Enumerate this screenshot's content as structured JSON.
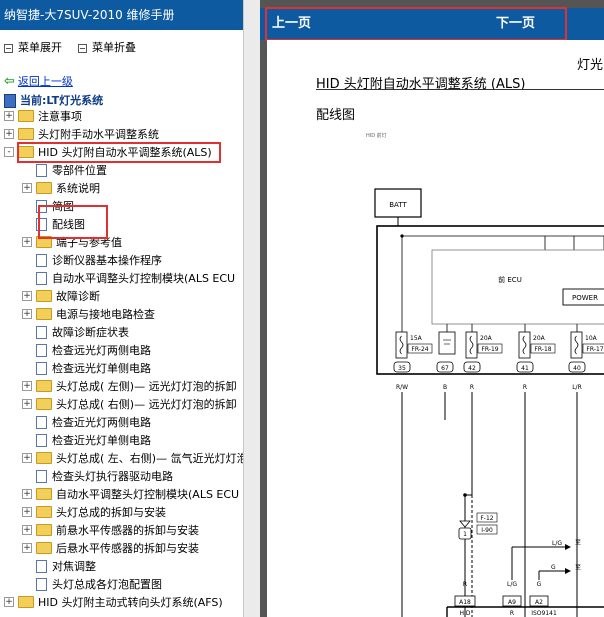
{
  "left_panel": {
    "title": "纳智捷-大7SUV-2010 维修手册",
    "expand_label": "菜单展开",
    "collapse_label": "菜单折叠",
    "back_label": "返回上一级",
    "current_label": "当前:LT灯光系统",
    "tree": [
      {
        "label": "注意事项",
        "type": "folder",
        "level": 0,
        "toggle": "+"
      },
      {
        "label": "头灯附手动水平调整系统",
        "type": "folder",
        "level": 0,
        "toggle": "+"
      },
      {
        "label": "HID 头灯附自动水平调整系统(ALS)",
        "type": "folder",
        "level": 0,
        "toggle": "-"
      },
      {
        "label": "零部件位置",
        "type": "doc",
        "level": 1
      },
      {
        "label": "系统说明",
        "type": "folder",
        "level": 1,
        "toggle": "+"
      },
      {
        "label": "简图",
        "type": "doc",
        "level": 1
      },
      {
        "label": "配线图",
        "type": "doc",
        "level": 1
      },
      {
        "label": "端子与参考值",
        "type": "folder",
        "level": 1,
        "toggle": "+"
      },
      {
        "label": "诊断仪器基本操作程序",
        "type": "doc",
        "level": 1
      },
      {
        "label": "自动水平调整头灯控制模块(ALS ECU",
        "type": "doc",
        "level": 1
      },
      {
        "label": "故障诊断",
        "type": "folder",
        "level": 1,
        "toggle": "+"
      },
      {
        "label": "电源与接地电路检查",
        "type": "folder",
        "level": 1,
        "toggle": "+"
      },
      {
        "label": "故障诊断症状表",
        "type": "doc",
        "level": 1
      },
      {
        "label": "检查远光灯两侧电路",
        "type": "doc",
        "level": 1
      },
      {
        "label": "检查远光灯单侧电路",
        "type": "doc",
        "level": 1
      },
      {
        "label": "头灯总成( 左侧)— 远光灯灯泡的拆卸",
        "type": "folder",
        "level": 1,
        "toggle": "+"
      },
      {
        "label": "头灯总成( 右侧)— 远光灯灯泡的拆卸",
        "type": "folder",
        "level": 1,
        "toggle": "+"
      },
      {
        "label": "检查近光灯两侧电路",
        "type": "doc",
        "level": 1
      },
      {
        "label": "检查近光灯单侧电路",
        "type": "doc",
        "level": 1
      },
      {
        "label": "头灯总成( 左、右侧)— 氙气近光灯灯泡",
        "type": "folder",
        "level": 1,
        "toggle": "+"
      },
      {
        "label": "检查头灯执行器驱动电路",
        "type": "doc",
        "level": 1
      },
      {
        "label": "自动水平调整头灯控制模块(ALS ECU",
        "type": "folder",
        "level": 1,
        "toggle": "+"
      },
      {
        "label": "头灯总成的拆卸与安装",
        "type": "folder",
        "level": 1,
        "toggle": "+"
      },
      {
        "label": "前悬水平传感器的拆卸与安装",
        "type": "folder",
        "level": 1,
        "toggle": "+"
      },
      {
        "label": "后悬水平传感器的拆卸与安装",
        "type": "folder",
        "level": 1,
        "toggle": "+"
      },
      {
        "label": "对焦调整",
        "type": "doc",
        "level": 1
      },
      {
        "label": "头灯总成各灯泡配置图",
        "type": "doc",
        "level": 1
      },
      {
        "label": "HID 头灯附主动式转向头灯系统(AFS)",
        "type": "folder",
        "level": 0,
        "toggle": "+"
      }
    ]
  },
  "nav": {
    "prev_label": "上一页",
    "next_label": "下一页"
  },
  "document": {
    "corner_text": "灯光",
    "section_title": "HID 头灯附自动水平调整系统 (ALS)",
    "sub_title": "配线图",
    "tiny_label": "HID 前灯",
    "batt_label": "BATT",
    "ecu_label": "前 ECU",
    "power_label": "POWER",
    "fuses": [
      {
        "amp": "15A",
        "code": "FR-24",
        "pin": "35",
        "wire": "R/W"
      },
      {
        "amp": "",
        "code": "",
        "pin": "67",
        "wire": "B"
      },
      {
        "amp": "20A",
        "code": "FR-19",
        "pin": "42",
        "wire": "R"
      },
      {
        "amp": "20A",
        "code": "FR-18",
        "pin": "41",
        "wire": "R"
      },
      {
        "amp": "10A",
        "code": "FR-17",
        "pin": "40",
        "wire": "L/R"
      }
    ],
    "connector_f12": "F-12",
    "connector_i90": "I-90",
    "connector_pin": "1",
    "wire_r": "R",
    "wire_lg": "L/G",
    "wire_g": "G",
    "side_text_1": "至",
    "side_text_2": "至",
    "bottom_pins": [
      "A18",
      "A9",
      "A2"
    ],
    "bottom_labels": [
      "HID",
      "R",
      "ISO9141"
    ]
  }
}
